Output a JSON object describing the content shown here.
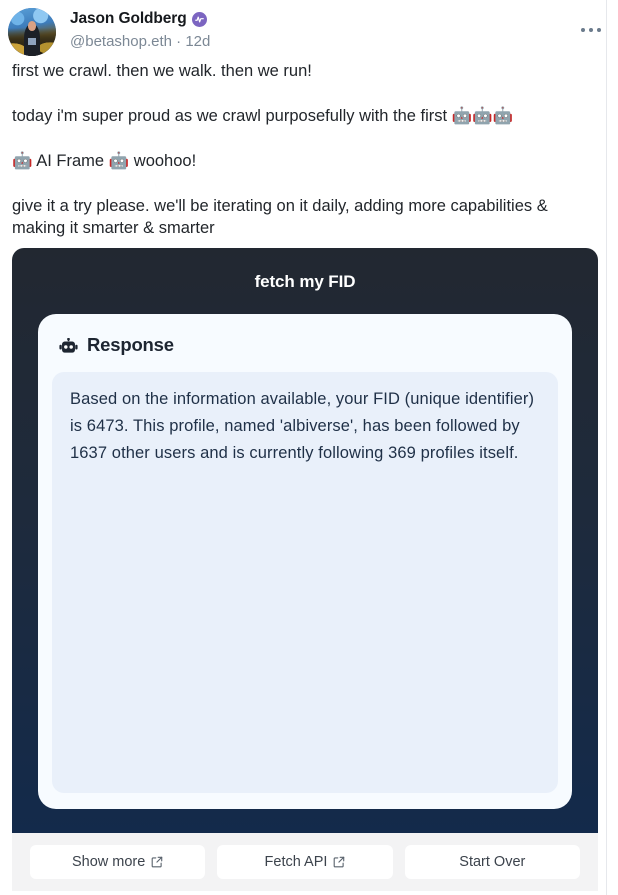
{
  "cast": {
    "author": {
      "display_name": "Jason Goldberg",
      "handle": "@betashop.eth",
      "separator": "·",
      "timestamp": "12d",
      "verified_badge_icon": "farcaster-power-badge-icon",
      "verified_badge_color": "#7c65c1",
      "avatar_icon": "user-avatar-photo"
    },
    "more_menu_icon": "ellipsis-horizontal-icon",
    "lines": [
      "first we crawl. then we walk. then we run!",
      "today i'm super proud as we crawl purposefully with the first 🤖🤖🤖",
      "🤖 AI Frame 🤖 woohoo!",
      "give it a try please. we'll be iterating on it daily, adding more capabilities & making it smarter & smarter"
    ]
  },
  "frame": {
    "title": "fetch my FID",
    "response": {
      "icon": "robot-head-icon",
      "heading": "Response",
      "text": "Based on the information available, your FID (unique identifier) is 6473. This profile, named 'albiverse', has been followed by 1637 other users and is currently following 369 profiles itself."
    },
    "buttons": [
      {
        "label": "Show more",
        "icon": "external-link-icon",
        "has_icon": true
      },
      {
        "label": "Fetch API",
        "icon": "external-link-icon",
        "has_icon": true
      },
      {
        "label": "Start Over",
        "icon": "",
        "has_icon": false
      }
    ]
  },
  "colors": {
    "frame_top": "#222831",
    "frame_bottom": "#132a4b",
    "response_card": "#f7fbff",
    "response_body": "#e9f0fa",
    "button_bar": "#f3f3f4",
    "text_primary": "#22262b",
    "text_muted": "#7c8895",
    "badge_purple": "#7c65c1"
  }
}
